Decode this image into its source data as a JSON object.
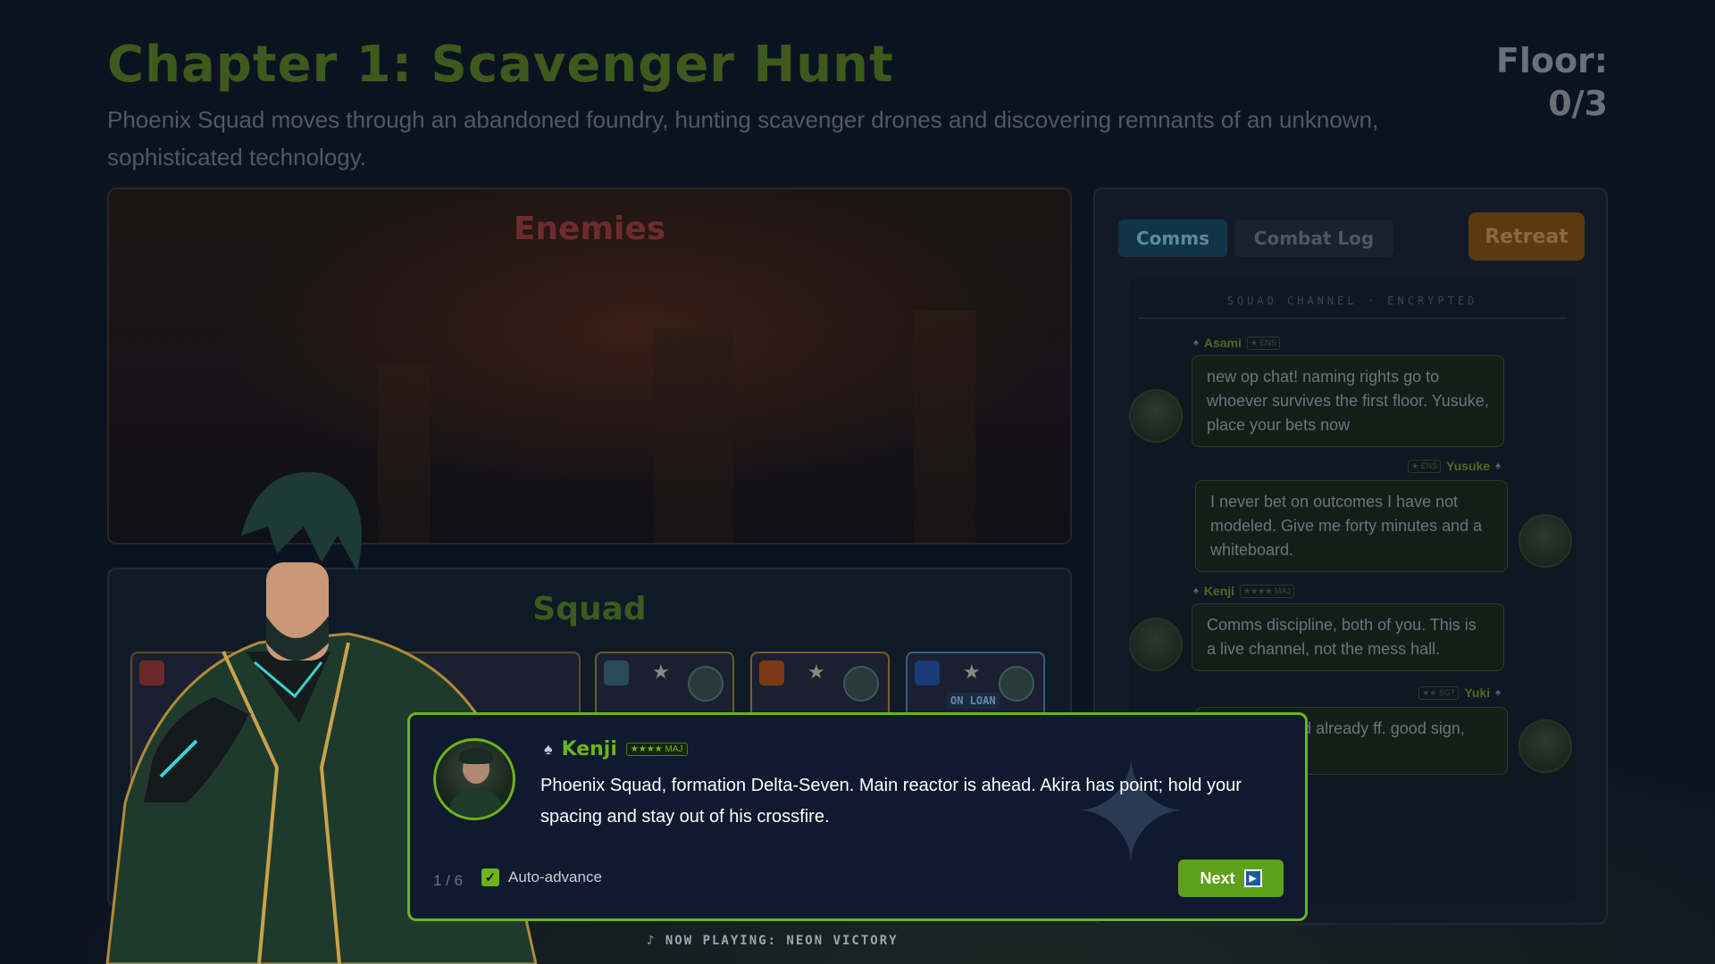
{
  "header": {
    "title": "Chapter 1: Scavenger Hunt",
    "description": "Phoenix Squad moves through an abandoned foundry, hunting scavenger drones and discovering remnants of an unknown, sophisticated technology.",
    "floor_label": "Floor:",
    "floor_value": "0/3"
  },
  "enemies": {
    "title": "Enemies"
  },
  "squad": {
    "title": "Squad",
    "units": [
      {
        "badge_color": "#2a4a5a",
        "frame_color": "#6a5a2a",
        "on_loan": ""
      },
      {
        "badge_color": "#7a3a1a",
        "frame_color": "#7a5a2a",
        "on_loan": ""
      },
      {
        "badge_color": "#1a3a7a",
        "frame_color": "#3a5a8a",
        "on_loan": "ON LOAN"
      }
    ]
  },
  "side_panel": {
    "tabs": [
      "Comms",
      "Combat Log"
    ],
    "active_tab": "Comms",
    "retreat_label": "Retreat",
    "channel_label": "SQUAD CHANNEL · ENCRYPTED",
    "messages": [
      {
        "name": "Asami",
        "rank": "★ ENS",
        "side": "left",
        "text": "new op chat! naming rights go to whoever survives the first floor. Yusuke, place your bets now"
      },
      {
        "name": "Yusuke",
        "rank": "★ ENS",
        "side": "right",
        "text": "I never bet on outcomes I have not modeled. Give me forty minutes and a whiteboard."
      },
      {
        "name": "Kenji",
        "rank": "★★★★ MAJ",
        "side": "left",
        "text": "Comms discipline, both of you. This is a live channel, not the mess hall."
      },
      {
        "name": "Yuki",
        "rank": "★★ SGT",
        "side": "right",
        "text": "yesterday and already ff. good sign, right?"
      }
    ]
  },
  "dialog": {
    "speaker": "Kenji",
    "rank": "★★★★ MAJ",
    "text": "Phoenix Squad, formation Delta-Seven. Main reactor is ahead. Akira has point; hold your spacing and stay out of his crossfire.",
    "progress": "1 / 6",
    "auto_advance_label": "Auto-advance",
    "auto_advance_checked": true,
    "next_label": "Next"
  },
  "now_playing": "♪ NOW PLAYING: NEON VICTORY",
  "colors": {
    "accent_green": "#6db31a",
    "retreat": "#5a3a10",
    "comms_tab": "#123448"
  }
}
